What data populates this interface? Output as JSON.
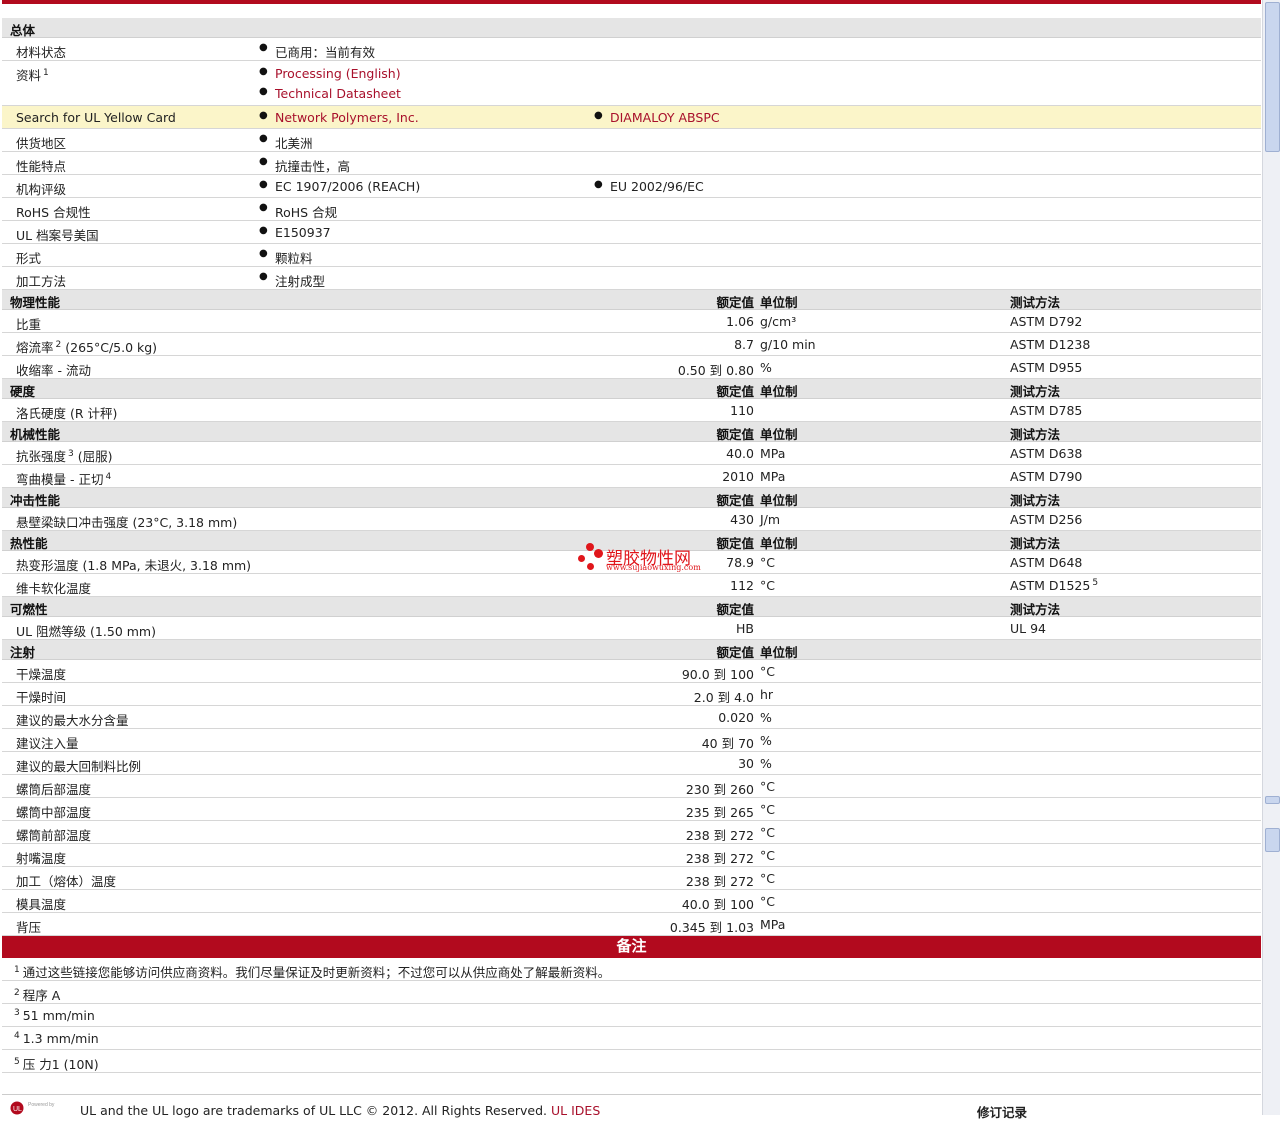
{
  "general": {
    "title": "总体",
    "status_label": "材料状态",
    "status_value": "已商用：当前有效",
    "docs_label": "资料",
    "docs_sup": "1",
    "docs_links": [
      "Processing (English)",
      "Technical Datasheet"
    ],
    "ul_label": "Search for UL Yellow Card",
    "ul_links": [
      "Network Polymers, Inc.",
      "DIAMALOY ABSPC"
    ],
    "region_label": "供货地区",
    "region_value": "北美洲",
    "feature_label": "性能特点",
    "feature_value": "抗撞击性，高",
    "agency_label": "机构评级",
    "agency_values": [
      "EC 1907/2006 (REACH)",
      "EU 2002/96/EC"
    ],
    "rohs_label": "RoHS 合规性",
    "rohs_value": "RoHS 合规",
    "ulfile_label": "UL 档案号美国",
    "ulfile_value": "E150937",
    "form_label": "形式",
    "form_value": "颗粒料",
    "process_label": "加工方法",
    "process_value": "注射成型"
  },
  "headers": {
    "nominal": "额定值",
    "unit": "单位制",
    "test": "测试方法"
  },
  "physical": {
    "title": "物理性能",
    "rows": [
      {
        "label": "比重",
        "sup": "",
        "value": "1.06",
        "unit": "g/cm³",
        "test": "ASTM D792",
        "test_sup": ""
      },
      {
        "label": "熔流率",
        "sup": "2",
        "suffix": "(265°C/5.0 kg)",
        "value": "8.7",
        "unit": "g/10 min",
        "test": "ASTM D1238",
        "test_sup": ""
      },
      {
        "label": "收缩率 - 流动",
        "sup": "",
        "value": "0.50 到 0.80",
        "unit": "%",
        "test": "ASTM D955",
        "test_sup": ""
      }
    ]
  },
  "hardness": {
    "title": "硬度",
    "rows": [
      {
        "label": "洛氏硬度 (R 计秤)",
        "sup": "",
        "value": "110",
        "unit": "",
        "test": "ASTM D785",
        "test_sup": ""
      }
    ]
  },
  "mechanical": {
    "title": "机械性能",
    "rows": [
      {
        "label": "抗张强度",
        "sup": "3",
        "suffix": "(屈服)",
        "value": "40.0",
        "unit": "MPa",
        "test": "ASTM D638",
        "test_sup": ""
      },
      {
        "label": "弯曲模量 - 正切",
        "sup": "4",
        "value": "2010",
        "unit": "MPa",
        "test": "ASTM D790",
        "test_sup": ""
      }
    ]
  },
  "impact": {
    "title": "冲击性能",
    "rows": [
      {
        "label": "悬壁梁缺口冲击强度 (23°C, 3.18 mm)",
        "sup": "",
        "value": "430",
        "unit": "J/m",
        "test": "ASTM D256",
        "test_sup": ""
      }
    ]
  },
  "thermal": {
    "title": "热性能",
    "rows": [
      {
        "label": "热变形温度 (1.8 MPa, 未退火, 3.18 mm)",
        "sup": "",
        "value": "78.9",
        "unit": "°C",
        "test": "ASTM D648",
        "test_sup": ""
      },
      {
        "label": "维卡软化温度",
        "sup": "",
        "value": "112",
        "unit": "°C",
        "test": "ASTM D1525",
        "test_sup": "5"
      }
    ]
  },
  "flammability": {
    "title": "可燃性",
    "rows": [
      {
        "label": "UL 阻燃等级 (1.50 mm)",
        "sup": "",
        "value": "HB",
        "unit": "",
        "test": "UL 94",
        "test_sup": ""
      }
    ]
  },
  "injection": {
    "title": "注射",
    "rows": [
      {
        "label": "干燥温度",
        "value": "90.0 到  100",
        "unit": "°C"
      },
      {
        "label": "干燥时间",
        "value": "2.0 到  4.0",
        "unit": "hr"
      },
      {
        "label": "建议的最大水分含量",
        "value": "0.020",
        "unit": "%"
      },
      {
        "label": "建议注入量",
        "value": "40 到  70",
        "unit": "%"
      },
      {
        "label": "建议的最大回制料比例",
        "value": "30",
        "unit": "%"
      },
      {
        "label": "螺筒后部温度",
        "value": "230 到  260",
        "unit": "°C"
      },
      {
        "label": "螺筒中部温度",
        "value": "235 到  265",
        "unit": "°C"
      },
      {
        "label": "螺筒前部温度",
        "value": "238 到  272",
        "unit": "°C"
      },
      {
        "label": "射嘴温度",
        "value": "238 到  272",
        "unit": "°C"
      },
      {
        "label": "加工（熔体）温度",
        "value": "238 到  272",
        "unit": "°C"
      },
      {
        "label": "模具温度",
        "value": "40.0 到  100",
        "unit": "°C"
      },
      {
        "label": "背压",
        "value": "0.345 到  1.03",
        "unit": "MPa"
      }
    ]
  },
  "notes": {
    "title": "备注",
    "items": [
      {
        "num": "1",
        "text": "通过这些链接您能够访问供应商资料。我们尽量保证及时更新资料；不过您可以从供应商处了解最新资料。"
      },
      {
        "num": "2",
        "text": "程序 A"
      },
      {
        "num": "3",
        "text": "51 mm/min"
      },
      {
        "num": "4",
        "text": "1.3 mm/min"
      },
      {
        "num": "5",
        "text": "压 力1 (10N)"
      }
    ]
  },
  "footer": {
    "powered_by": "Powered by",
    "text": "UL and the UL logo are trademarks of UL LLC © 2012. All Rights Reserved.",
    "link": "UL IDES",
    "revision": "修订记录"
  },
  "watermark": {
    "name": "塑胶物性网",
    "url": "www.sujiaowuxing.com"
  },
  "colors": {
    "accent": "#b20a1e",
    "link": "#a8102b",
    "highlight": "#fbf5c9"
  }
}
